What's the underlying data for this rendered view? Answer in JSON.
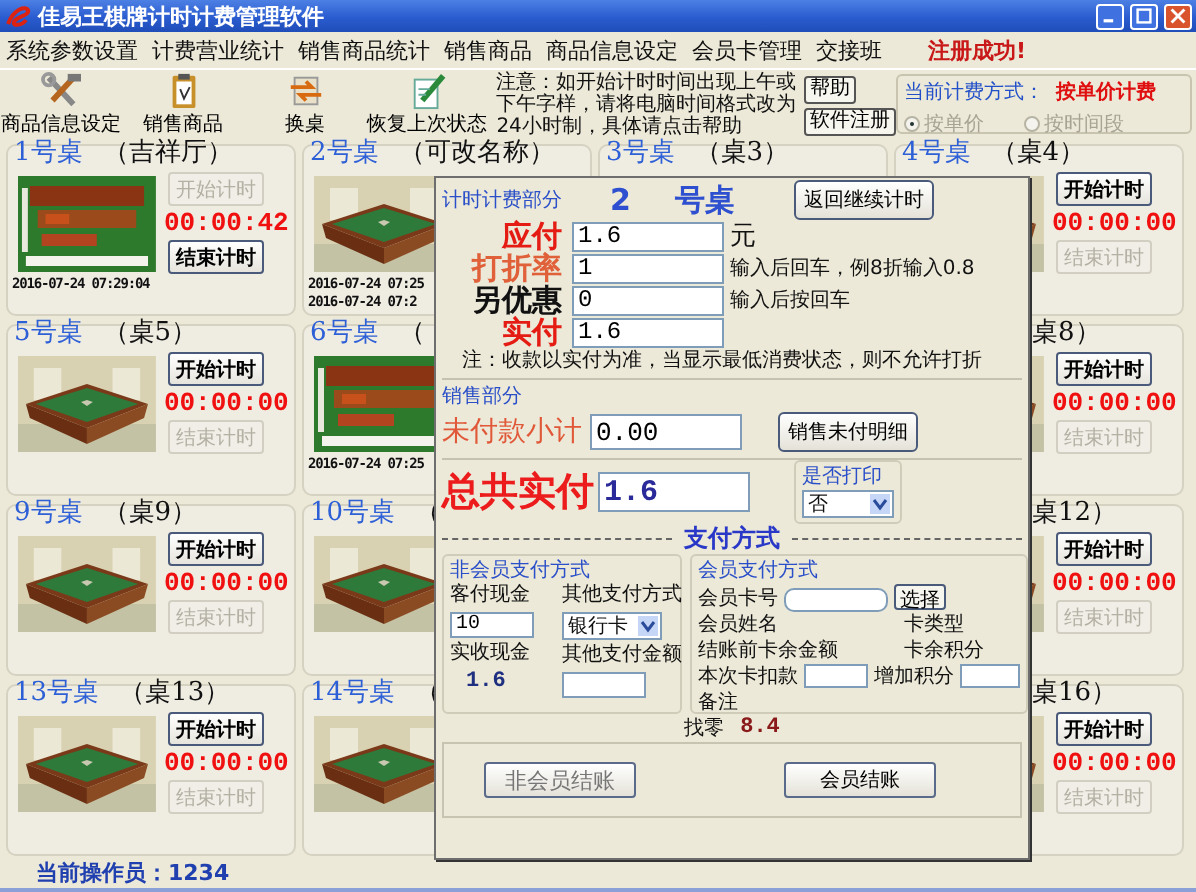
{
  "window": {
    "title": "佳易王棋牌计时计费管理软件"
  },
  "menu": [
    "系统参数设置",
    "计费营业统计",
    "销售商品统计",
    "销售商品",
    "商品信息设定",
    "会员卡管理",
    "交接班"
  ],
  "registration_status": "注册成功!",
  "toolbar": [
    {
      "label": "商品信息设定",
      "kind": "tools"
    },
    {
      "label": "销售商品",
      "kind": "clipboard"
    },
    {
      "label": "换桌",
      "kind": "swap"
    },
    {
      "label": "恢复上次状态",
      "kind": "restore"
    }
  ],
  "notice": {
    "text": "注意：如开始计时时间出现上午或下午字样，请将电脑时间格式改为24小时制，具体请点击帮助",
    "buttons": [
      "帮助",
      "软件注册"
    ]
  },
  "billing_mode": {
    "label": "当前计费方式：",
    "value": "按单价计费",
    "disabled": true,
    "options": [
      {
        "label": "按单价",
        "selected": true
      },
      {
        "label": "按时间段",
        "selected": false
      }
    ]
  },
  "tables": [
    {
      "title": "1号桌",
      "name": "（吉祥厅）",
      "kind": "timing",
      "start": {
        "label": "开始计时",
        "disabled": true
      },
      "time": "00:00:42",
      "end": {
        "label": "结束计时",
        "disabled": false
      },
      "stamps": [
        "2016-07-24 07:29:04"
      ]
    },
    {
      "title": "2号桌",
      "name": "（可改名称）",
      "kind": "idle",
      "stamps": [
        "2016-07-24 07:25",
        "2016-07-24 07:2"
      ]
    },
    {
      "title": "3号桌",
      "name": "（桌3）",
      "kind": "covered"
    },
    {
      "title": "4号桌",
      "name": "（桌4）",
      "kind": "idle",
      "start": {
        "label": "开始计时",
        "disabled": false
      },
      "time": "00:00:00",
      "end": {
        "label": "结束计时",
        "disabled": true
      }
    },
    {
      "title": "5号桌",
      "name": "（桌5）",
      "kind": "idle",
      "start": {
        "label": "开始计时",
        "disabled": false
      },
      "time": "00:00:00",
      "end": {
        "label": "结束计时",
        "disabled": true
      }
    },
    {
      "title": "6号桌",
      "name": "（",
      "kind": "timing",
      "stamps": [
        "2016-07-24 07:25"
      ]
    },
    {
      "kind": "covered"
    },
    {
      "name": "桌8）",
      "kind": "idle",
      "start": {
        "label": "开始计时",
        "disabled": false
      },
      "time": "00:00:00",
      "end": {
        "label": "结束计时",
        "disabled": true
      }
    },
    {
      "title": "9号桌",
      "name": "（桌9）",
      "kind": "idle",
      "start": {
        "label": "开始计时",
        "disabled": false
      },
      "time": "00:00:00",
      "end": {
        "label": "结束计时",
        "disabled": true
      }
    },
    {
      "title": "10号桌",
      "name": "（",
      "kind": "idle"
    },
    {
      "kind": "covered"
    },
    {
      "name": "桌12）",
      "kind": "idle",
      "start": {
        "label": "开始计时",
        "disabled": false
      },
      "time": "00:00:00",
      "end": {
        "label": "结束计时",
        "disabled": true
      }
    },
    {
      "title": "13号桌",
      "name": "（桌13）",
      "kind": "idle",
      "start": {
        "label": "开始计时",
        "disabled": false
      },
      "time": "00:00:00",
      "end": {
        "label": "结束计时",
        "disabled": true
      }
    },
    {
      "title": "14号桌",
      "name": "（",
      "kind": "idle"
    },
    {
      "kind": "covered"
    },
    {
      "name": "桌16）",
      "kind": "idle",
      "start": {
        "label": "开始计时",
        "disabled": false
      },
      "time": "00:00:00",
      "end": {
        "label": "结束计时",
        "disabled": true
      }
    }
  ],
  "operator": "当前操作员：1234",
  "checkout": {
    "section_label": "计时计费部分",
    "table_no": "2",
    "table_suffix": "号桌",
    "return_button": "返回继续计时",
    "fields": [
      {
        "label": "应付",
        "value": "1.6",
        "unit": "元",
        "kind": "due"
      },
      {
        "label": "打折率",
        "value": "1",
        "hint": "输入后回车，例8折输入0.8",
        "kind": "discount"
      },
      {
        "label": "另优惠",
        "value": "0",
        "hint": "输入后按回车",
        "kind": "extra"
      },
      {
        "label": "实付",
        "value": "1.6",
        "kind": "due"
      }
    ],
    "note": "注：收款以实付为准，当显示最低消费状态，则不允许打折",
    "sales": {
      "label": "销售部分",
      "subtotal_label": "未付款小计",
      "subtotal": "0.00",
      "button": "销售未付明细"
    },
    "total": {
      "label": "总共实付",
      "value": "1.6"
    },
    "print": {
      "label": "是否打印",
      "value": "否"
    },
    "payment_heading": "支付方式",
    "non_member": {
      "label": "非会员支付方式",
      "cash_label": "客付现金",
      "cash": "10",
      "received_label": "实收现金",
      "received": "1.6",
      "other_label": "其他支付方式",
      "other_method": "银行卡",
      "other_amount_label": "其他支付金额"
    },
    "member": {
      "label": "会员支付方式",
      "card_no_label": "会员卡号",
      "choose_button": "选择",
      "name_label": "会员姓名",
      "card_type_label": "卡类型",
      "balance_label": "结账前卡余金额",
      "points_label": "卡余积分",
      "deduct_label": "本次卡扣款",
      "add_points_label": "增加积分",
      "remark_label": "备注"
    },
    "change_label": "找零",
    "change": "8.4",
    "buttons": [
      "非会员结账",
      "会员结账"
    ]
  }
}
